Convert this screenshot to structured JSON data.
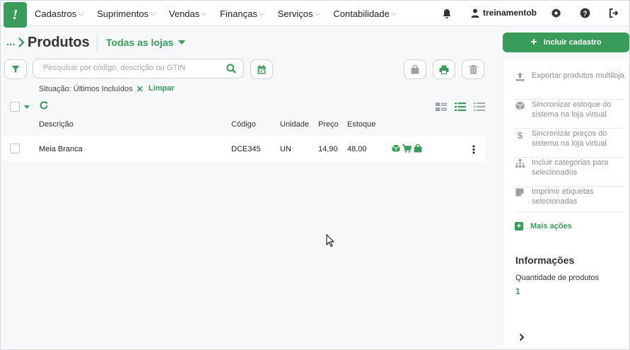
{
  "brand": {
    "logo_glyph": "!",
    "accent": "#3a9c5a"
  },
  "nav": {
    "items": [
      {
        "label": "Cadastros"
      },
      {
        "label": "Suprimentos"
      },
      {
        "label": "Vendas"
      },
      {
        "label": "Finanças"
      },
      {
        "label": "Serviços"
      },
      {
        "label": "Contabilidade"
      }
    ],
    "username": "treinamentob"
  },
  "header": {
    "crumb": "...",
    "title": "Produtos",
    "store_selector": "Todas as lojas"
  },
  "search": {
    "placeholder": "Pesquisar por código, descrição ou GTIN",
    "value": ""
  },
  "filter": {
    "text": "Situação: Últimos Incluídos",
    "clear_label": "Limpar"
  },
  "table": {
    "columns": [
      "Descrição",
      "Código",
      "Unidade",
      "Preço",
      "Estoque"
    ],
    "rows": [
      {
        "descricao": "Meia Branca",
        "codigo": "DCE345",
        "unidade": "UN",
        "preco": "14,90",
        "estoque": "48,00"
      }
    ]
  },
  "sidebar": {
    "add_label": "Incluir cadastro",
    "actions": [
      {
        "label": "Exportar produtos multiloja",
        "icon": "upload-icon"
      },
      {
        "label": "Sincronizar estoque do sistema na loja virtual",
        "icon": "box-icon"
      },
      {
        "label": "Sincronizar preços do sistema na loja virtual",
        "icon": "dollar-icon"
      },
      {
        "label": "Incluir categorias para selecionados",
        "icon": "sitemap-icon"
      },
      {
        "label": "Imprimir etiquetas selecionadas",
        "icon": "note-icon"
      }
    ],
    "more_label": "Mais ações",
    "info_title": "Informações",
    "info_label": "Quantidade de produtos",
    "info_value": "1"
  }
}
